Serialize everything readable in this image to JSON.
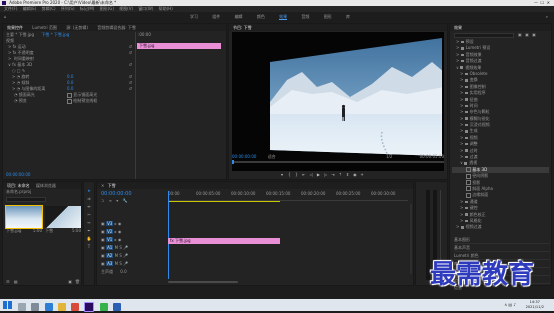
{
  "titlebar": {
    "title": "Adobe Premiere Pro 2020 - C:\\用户\\Video\\最新\\未命名 *"
  },
  "menubar": {
    "items": [
      "文件(F)",
      "编辑(E)",
      "剪辑(C)",
      "序列(S)",
      "标记(M)",
      "图形(G)",
      "视图(V)",
      "窗口(W)",
      "帮助(H)"
    ]
  },
  "workspaces": {
    "items": [
      "学习",
      "组件",
      "编辑",
      "颜色",
      "效果",
      "音频",
      "图形",
      "库"
    ],
    "active_index": 4
  },
  "effect_controls": {
    "tabs": [
      "效果控件",
      "Lumetri 范围",
      "源: (无剪辑)",
      "音频剪辑混合器: 下雪"
    ],
    "source": "主要 * 下雪.jpg",
    "sequence": "下雪 * 下雪.jpg",
    "timecode_start": ":00:00",
    "video_label": "视频",
    "clip_label": "下雪.jpg",
    "properties": [
      {
        "label": "运动",
        "value": ""
      },
      {
        "label": "不透明度",
        "value": ""
      },
      {
        "label": "时间重映射",
        "value": ""
      },
      {
        "label": "基本 3D",
        "value": ""
      },
      {
        "label": "旋转",
        "value": "0.0"
      },
      {
        "label": "倾斜",
        "value": "0.0"
      },
      {
        "label": "与图像的距离",
        "value": "0.0"
      },
      {
        "label": "镜面高光",
        "check": "显示镜面高光"
      },
      {
        "label": "预览",
        "check": "绘制预览线框"
      }
    ],
    "timecode": "00:00:00:00"
  },
  "program": {
    "tab": "节目: 下雪",
    "timecode": "00:00:00:00",
    "fit": "适合",
    "fraction": "1/2",
    "duration": "00:00:05:00"
  },
  "project": {
    "tabs": [
      "项目: 未命名",
      "媒体浏览器"
    ],
    "name": "未命名.prproj",
    "items": [
      {
        "name": "下雪.jpg",
        "duration": "5:00"
      },
      {
        "name": "下雪",
        "duration": "5:00"
      }
    ]
  },
  "timeline": {
    "tab": "下雪",
    "timecode": "00:00:00:00",
    "tracks": [
      "V3",
      "V2",
      "V1",
      "A1",
      "A2",
      "A3"
    ],
    "master": "主声道",
    "master_value": "0.0",
    "clip": "fx 下雪.jpg",
    "ruler": [
      "00:00",
      "00:00:05:00",
      "00:00:10:00",
      "00:00:15:00",
      "00:00:20:00",
      "00:00:25:00",
      "00:00:30:00"
    ]
  },
  "effects": {
    "tab": "效果",
    "tree": [
      {
        "label": "预设",
        "indent": 1
      },
      {
        "label": "Lumetri 预设",
        "indent": 1
      },
      {
        "label": "音频效果",
        "indent": 1
      },
      {
        "label": "音频过渡",
        "indent": 1
      },
      {
        "label": "视频效果",
        "indent": 1
      },
      {
        "label": "Obsolete",
        "indent": 2
      },
      {
        "label": "变换",
        "indent": 2
      },
      {
        "label": "图像控制",
        "indent": 2
      },
      {
        "label": "实用程序",
        "indent": 2
      },
      {
        "label": "扭曲",
        "indent": 2
      },
      {
        "label": "时间",
        "indent": 2
      },
      {
        "label": "杂色与颗粒",
        "indent": 2
      },
      {
        "label": "模糊与锐化",
        "indent": 2
      },
      {
        "label": "沉浸式视频",
        "indent": 2
      },
      {
        "label": "生成",
        "indent": 2
      },
      {
        "label": "视频",
        "indent": 2
      },
      {
        "label": "调整",
        "indent": 2
      },
      {
        "label": "过时",
        "indent": 2
      },
      {
        "label": "过渡",
        "indent": 2
      },
      {
        "label": "透视",
        "indent": 2
      },
      {
        "label": "基本 3D",
        "indent": 3,
        "selected": true
      },
      {
        "label": "径向阴影",
        "indent": 3
      },
      {
        "label": "投影",
        "indent": 3
      },
      {
        "label": "斜面 Alpha",
        "indent": 3
      },
      {
        "label": "边缘斜面",
        "indent": 3
      },
      {
        "label": "通道",
        "indent": 2
      },
      {
        "label": "键控",
        "indent": 2
      },
      {
        "label": "颜色校正",
        "indent": 2
      },
      {
        "label": "风格化",
        "indent": 2
      },
      {
        "label": "视频过渡",
        "indent": 1
      }
    ],
    "extra_panels": [
      "基本图形",
      "基本声音",
      "Lumetri 颜色",
      "库",
      "标记",
      "历史记录",
      "信息"
    ]
  },
  "taskbar": {
    "time": "14:37",
    "date": "2021/11/2"
  },
  "watermark": "最需教育"
}
